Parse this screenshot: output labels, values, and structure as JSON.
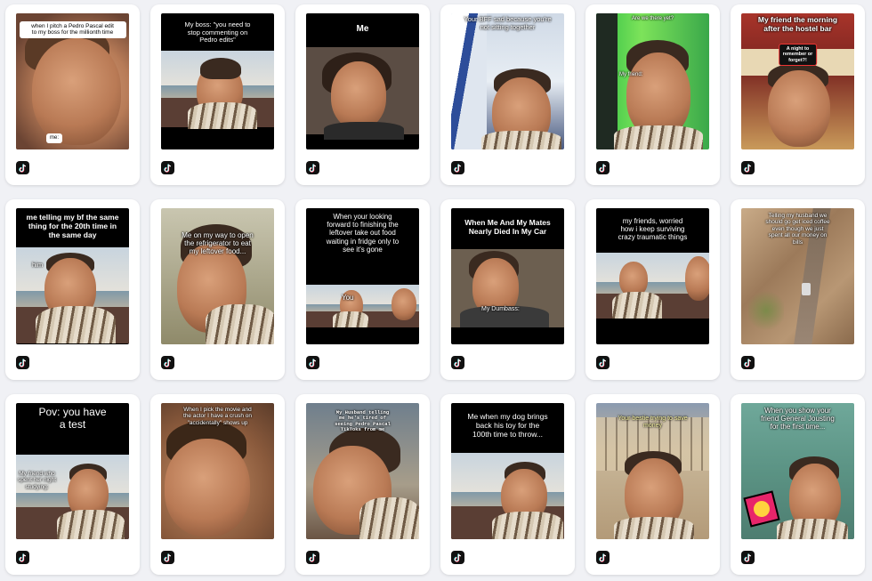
{
  "grid": {
    "background": "#f0f1f5",
    "icon": "tiktok-icon",
    "cards": [
      {
        "captions": [
          "when I pitch a Pedro Pascal edit\nto my boss for the millionth time",
          "me:"
        ]
      },
      {
        "captions": [
          "My boss: \"you need to\nstop commenting on\nPedro edits\""
        ]
      },
      {
        "captions": [
          "Me"
        ]
      },
      {
        "captions": [
          "Your BFF sad because you're\nnot sitting together"
        ]
      },
      {
        "captions": [
          "Are we there yet?",
          "My friend:"
        ]
      },
      {
        "captions": [
          "My friend the morning\nafter the hostel bar",
          "A night to\nremember or\nforget?!"
        ]
      },
      {
        "captions": [
          "me telling my bf the same\nthing for the 20th time in\nthe same day",
          "him"
        ]
      },
      {
        "captions": [
          "Me on my way to open\nthe refrigerator to eat\nmy leftover food..."
        ]
      },
      {
        "captions": [
          "When your looking\nforward to finishing the\nleftover take out food\nwaiting in fridge only to\nsee it's gone",
          "You"
        ]
      },
      {
        "captions": [
          "When Me And My Mates\nNearly Died In My Car",
          "My Dumbass:"
        ]
      },
      {
        "captions": [
          "my friends, worried\nhow i keep surviving\ncrazy traumatic things"
        ]
      },
      {
        "captions": [
          "Telling my husband we\nshould go get iced coffee\neven though we just\nspent all our money on\nbills"
        ]
      },
      {
        "captions": [
          "Pov: you have\na test",
          "My friend who\nspent her night\nstudying:"
        ]
      },
      {
        "captions": [
          "When I pick the movie and\nthe actor I have a crush on\n\"accidentally\" shows up"
        ]
      },
      {
        "captions": [
          "My Husband telling\nme he's tired of\nseeing Pedro Pascal\nTikToks from me"
        ]
      },
      {
        "captions": [
          "Me when my dog brings\nback his toy for the\n100th time to throw..."
        ]
      },
      {
        "captions": [
          "Your bestie trying to save\nmoney"
        ]
      },
      {
        "captions": [
          "When you show your\nfriend General Jousting\nfor the first time..."
        ]
      }
    ]
  }
}
